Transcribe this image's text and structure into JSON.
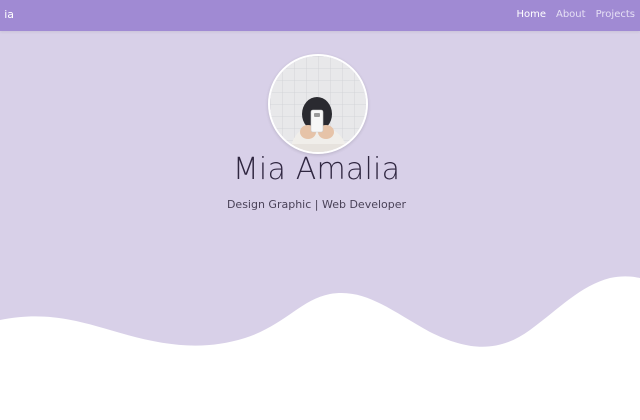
{
  "navbar": {
    "brand": "ia",
    "links": [
      {
        "label": "Home",
        "active": true
      },
      {
        "label": "About",
        "active": false
      },
      {
        "label": "Projects",
        "active": false
      }
    ]
  },
  "hero": {
    "name": "Mia Amalia",
    "tagline": "Design Graphic | Web Developer",
    "avatar_icon": "profile-photo"
  },
  "colors": {
    "navbar": "#a08ad3",
    "hero_background": "#d8d0e8",
    "wave": "#ffffff",
    "name_text": "#2f2640"
  }
}
